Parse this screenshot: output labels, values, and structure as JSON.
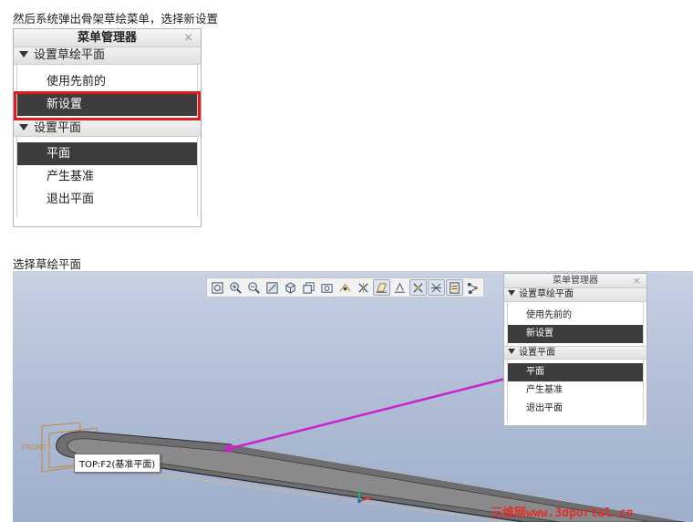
{
  "captions": {
    "top": "然后系统弹出骨架草绘菜单，选择新设置",
    "middle": "选择草绘平面"
  },
  "menu_manager": {
    "title": "菜单管理器",
    "close_glyph": "×",
    "section1": {
      "label": "设置草绘平面",
      "items": [
        {
          "label": "使用先前的",
          "selected": false
        },
        {
          "label": "新设置",
          "selected": true
        }
      ]
    },
    "section2": {
      "label": "设置平面",
      "items": [
        {
          "label": "平面",
          "selected": true
        },
        {
          "label": "产生基准",
          "selected": false
        },
        {
          "label": "退出平面",
          "selected": false
        }
      ]
    }
  },
  "viewport": {
    "toolbar_icons": [
      "zoom-window-icon",
      "zoom-in-icon",
      "zoom-out-icon",
      "repaint-icon",
      "view-orient-icon",
      "saved-views-icon",
      "layers-icon",
      "spin-center-icon",
      "datum-planes-icon",
      "datum-axes-icon",
      "datum-points-icon",
      "coord-sys-icon",
      "annotations-icon",
      "sketch-display-icon",
      "node-icon"
    ],
    "tooltip": "TOP:F2(基准平面)",
    "front_label": "FRONT",
    "watermark_cn": "三维网",
    "watermark_url": "www.3dportal.cn"
  },
  "colors": {
    "highlight_red": "#e21c1c",
    "selected_bg": "#3d3d3d",
    "arrow_magenta": "#cc22cc"
  }
}
